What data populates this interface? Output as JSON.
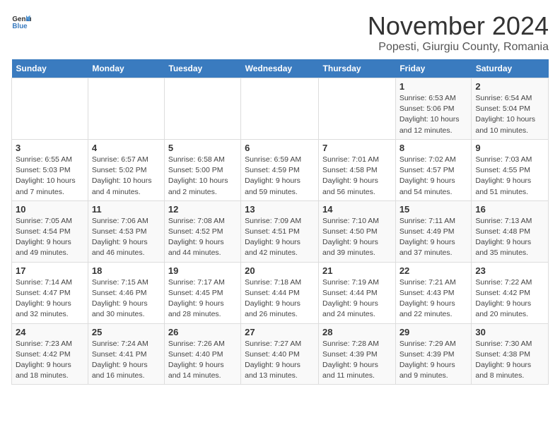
{
  "header": {
    "logo_general": "General",
    "logo_blue": "Blue",
    "month_title": "November 2024",
    "subtitle": "Popesti, Giurgiu County, Romania"
  },
  "days_of_week": [
    "Sunday",
    "Monday",
    "Tuesday",
    "Wednesday",
    "Thursday",
    "Friday",
    "Saturday"
  ],
  "weeks": [
    [
      {
        "day": "",
        "info": ""
      },
      {
        "day": "",
        "info": ""
      },
      {
        "day": "",
        "info": ""
      },
      {
        "day": "",
        "info": ""
      },
      {
        "day": "",
        "info": ""
      },
      {
        "day": "1",
        "info": "Sunrise: 6:53 AM\nSunset: 5:06 PM\nDaylight: 10 hours and 12 minutes."
      },
      {
        "day": "2",
        "info": "Sunrise: 6:54 AM\nSunset: 5:04 PM\nDaylight: 10 hours and 10 minutes."
      }
    ],
    [
      {
        "day": "3",
        "info": "Sunrise: 6:55 AM\nSunset: 5:03 PM\nDaylight: 10 hours and 7 minutes."
      },
      {
        "day": "4",
        "info": "Sunrise: 6:57 AM\nSunset: 5:02 PM\nDaylight: 10 hours and 4 minutes."
      },
      {
        "day": "5",
        "info": "Sunrise: 6:58 AM\nSunset: 5:00 PM\nDaylight: 10 hours and 2 minutes."
      },
      {
        "day": "6",
        "info": "Sunrise: 6:59 AM\nSunset: 4:59 PM\nDaylight: 9 hours and 59 minutes."
      },
      {
        "day": "7",
        "info": "Sunrise: 7:01 AM\nSunset: 4:58 PM\nDaylight: 9 hours and 56 minutes."
      },
      {
        "day": "8",
        "info": "Sunrise: 7:02 AM\nSunset: 4:57 PM\nDaylight: 9 hours and 54 minutes."
      },
      {
        "day": "9",
        "info": "Sunrise: 7:03 AM\nSunset: 4:55 PM\nDaylight: 9 hours and 51 minutes."
      }
    ],
    [
      {
        "day": "10",
        "info": "Sunrise: 7:05 AM\nSunset: 4:54 PM\nDaylight: 9 hours and 49 minutes."
      },
      {
        "day": "11",
        "info": "Sunrise: 7:06 AM\nSunset: 4:53 PM\nDaylight: 9 hours and 46 minutes."
      },
      {
        "day": "12",
        "info": "Sunrise: 7:08 AM\nSunset: 4:52 PM\nDaylight: 9 hours and 44 minutes."
      },
      {
        "day": "13",
        "info": "Sunrise: 7:09 AM\nSunset: 4:51 PM\nDaylight: 9 hours and 42 minutes."
      },
      {
        "day": "14",
        "info": "Sunrise: 7:10 AM\nSunset: 4:50 PM\nDaylight: 9 hours and 39 minutes."
      },
      {
        "day": "15",
        "info": "Sunrise: 7:11 AM\nSunset: 4:49 PM\nDaylight: 9 hours and 37 minutes."
      },
      {
        "day": "16",
        "info": "Sunrise: 7:13 AM\nSunset: 4:48 PM\nDaylight: 9 hours and 35 minutes."
      }
    ],
    [
      {
        "day": "17",
        "info": "Sunrise: 7:14 AM\nSunset: 4:47 PM\nDaylight: 9 hours and 32 minutes."
      },
      {
        "day": "18",
        "info": "Sunrise: 7:15 AM\nSunset: 4:46 PM\nDaylight: 9 hours and 30 minutes."
      },
      {
        "day": "19",
        "info": "Sunrise: 7:17 AM\nSunset: 4:45 PM\nDaylight: 9 hours and 28 minutes."
      },
      {
        "day": "20",
        "info": "Sunrise: 7:18 AM\nSunset: 4:44 PM\nDaylight: 9 hours and 26 minutes."
      },
      {
        "day": "21",
        "info": "Sunrise: 7:19 AM\nSunset: 4:44 PM\nDaylight: 9 hours and 24 minutes."
      },
      {
        "day": "22",
        "info": "Sunrise: 7:21 AM\nSunset: 4:43 PM\nDaylight: 9 hours and 22 minutes."
      },
      {
        "day": "23",
        "info": "Sunrise: 7:22 AM\nSunset: 4:42 PM\nDaylight: 9 hours and 20 minutes."
      }
    ],
    [
      {
        "day": "24",
        "info": "Sunrise: 7:23 AM\nSunset: 4:42 PM\nDaylight: 9 hours and 18 minutes."
      },
      {
        "day": "25",
        "info": "Sunrise: 7:24 AM\nSunset: 4:41 PM\nDaylight: 9 hours and 16 minutes."
      },
      {
        "day": "26",
        "info": "Sunrise: 7:26 AM\nSunset: 4:40 PM\nDaylight: 9 hours and 14 minutes."
      },
      {
        "day": "27",
        "info": "Sunrise: 7:27 AM\nSunset: 4:40 PM\nDaylight: 9 hours and 13 minutes."
      },
      {
        "day": "28",
        "info": "Sunrise: 7:28 AM\nSunset: 4:39 PM\nDaylight: 9 hours and 11 minutes."
      },
      {
        "day": "29",
        "info": "Sunrise: 7:29 AM\nSunset: 4:39 PM\nDaylight: 9 hours and 9 minutes."
      },
      {
        "day": "30",
        "info": "Sunrise: 7:30 AM\nSunset: 4:38 PM\nDaylight: 9 hours and 8 minutes."
      }
    ]
  ]
}
